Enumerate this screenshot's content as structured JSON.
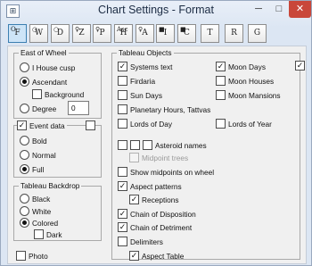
{
  "window": {
    "title": "Chart Settings - Format",
    "controls": {
      "minimize": "─",
      "maximize": "□",
      "close": "✕"
    }
  },
  "toolbar": [
    {
      "icon": "format-icon",
      "glyph": "F",
      "corner": "O"
    },
    {
      "icon": "wheel-icon",
      "glyph": "W",
      "corner": "○"
    },
    {
      "icon": "d-icon",
      "glyph": "D",
      "corner": "○"
    },
    {
      "icon": "z-icon",
      "glyph": "Z",
      "corner": "♀"
    },
    {
      "icon": "p-icon",
      "glyph": "P",
      "corner": "♀"
    },
    {
      "icon": "h-icon",
      "glyph": "H",
      "corner": "Asc"
    },
    {
      "icon": "a-icon",
      "glyph": "A",
      "corner": "♀"
    },
    {
      "icon": "i-icon",
      "glyph": "I",
      "corner": "■"
    },
    {
      "icon": "c-icon",
      "glyph": "C",
      "corner": "■"
    },
    {
      "icon": "t-icon",
      "glyph": "T",
      "corner": ""
    },
    {
      "icon": "r-icon",
      "glyph": "R",
      "corner": ""
    },
    {
      "icon": "g-icon",
      "glyph": "G",
      "corner": ""
    }
  ],
  "east": {
    "title": "East of Wheel",
    "options": [
      "I House cusp",
      "Ascendant",
      "Degree"
    ],
    "selected": "Ascendant",
    "background_label": "Background",
    "degree_value": "0"
  },
  "event": {
    "label": "Event data",
    "checked": true,
    "options": [
      "Bold",
      "Normal",
      "Full"
    ],
    "selected": "Full"
  },
  "backdrop": {
    "title": "Tableau Backdrop",
    "options": [
      "Black",
      "White",
      "Colored"
    ],
    "selected": "Colored",
    "dark_label": "Dark"
  },
  "photo_label": "Photo",
  "objects": {
    "title": "Tableau Objects",
    "col1": [
      {
        "label": "Systems text",
        "checked": true
      },
      {
        "label": "Firdaria",
        "checked": false
      },
      {
        "label": "Sun Days",
        "checked": false
      },
      {
        "label": "Planetary Hours, Tattvas",
        "checked": false
      },
      {
        "label": "Lords of Day",
        "checked": false
      }
    ],
    "col2": [
      {
        "label": "Moon Days",
        "checked": true
      },
      {
        "label": "Moon Houses",
        "checked": false
      },
      {
        "label": "Moon Mansions",
        "checked": false
      },
      {
        "label": "Lords of Year",
        "checked": false
      }
    ],
    "asteroid_label": "Asteroid names",
    "midpoint_trees_label": "Midpoint trees",
    "list": [
      {
        "label": "Show midpoints on wheel",
        "checked": false,
        "indent": 0
      },
      {
        "label": "Aspect patterns",
        "checked": true,
        "indent": 0
      },
      {
        "label": "Receptions",
        "checked": true,
        "indent": 1
      },
      {
        "label": "Chain of Disposition",
        "checked": true,
        "indent": 0
      },
      {
        "label": "Chain of Detriment",
        "checked": true,
        "indent": 0
      },
      {
        "label": "Delimiters",
        "checked": false,
        "indent": 0
      },
      {
        "label": "Aspect Table",
        "checked": true,
        "indent": 1
      }
    ]
  }
}
